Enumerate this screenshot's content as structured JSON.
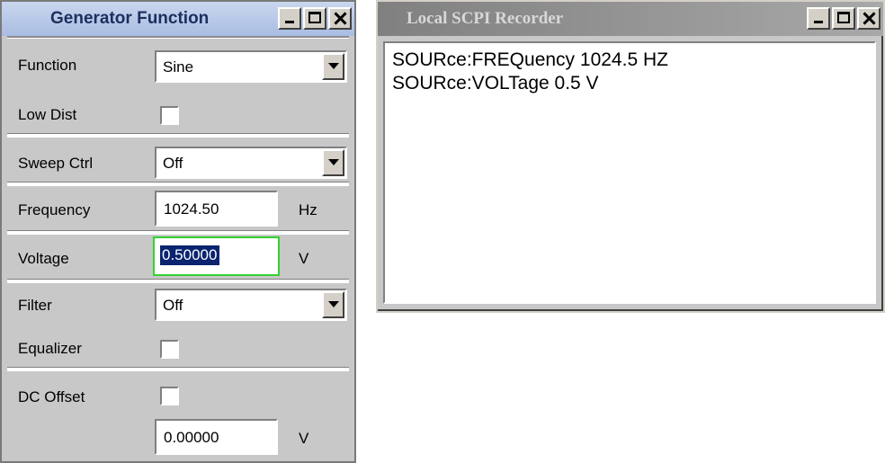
{
  "generator": {
    "title": "Generator Function",
    "function": {
      "label": "Function",
      "value": "Sine"
    },
    "low_dist": {
      "label": "Low Dist",
      "checked": false
    },
    "sweep_ctrl": {
      "label": "Sweep Ctrl",
      "value": "Off"
    },
    "frequency": {
      "label": "Frequency",
      "value": "1024.50",
      "unit": "Hz"
    },
    "voltage": {
      "label": "Voltage",
      "value": "0.50000",
      "unit": "V"
    },
    "filter": {
      "label": "Filter",
      "value": "Off"
    },
    "equalizer": {
      "label": "Equalizer",
      "checked": false
    },
    "dc_offset": {
      "label": "DC Offset",
      "checked": false,
      "value": "0.00000",
      "unit": "V"
    }
  },
  "recorder": {
    "title": "Local SCPI Recorder",
    "lines": [
      "SOURce:FREQuency 1024.5 HZ",
      "SOURce:VOLTage 0.5 V"
    ]
  }
}
